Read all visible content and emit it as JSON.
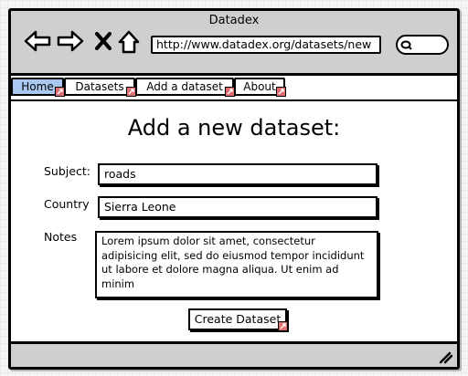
{
  "window": {
    "title": "Datadex"
  },
  "browser": {
    "url": "http://www.datadex.org/datasets/new"
  },
  "tabs": [
    {
      "label": "Home",
      "active": true
    },
    {
      "label": "Datasets",
      "active": false
    },
    {
      "label": "Add a dataset",
      "active": false
    },
    {
      "label": "About",
      "active": false
    }
  ],
  "form": {
    "heading": "Add a new dataset:",
    "subject_label": "Subject:",
    "subject_value": "roads",
    "country_label": "Country",
    "country_value": "Sierra Leone",
    "notes_label": "Notes",
    "notes_value": "Lorem ipsum dolor sit amet, consectetur adipisicing elit, sed do eiusmod tempor incididunt ut labore et dolore magna aliqua. Ut enim ad minim",
    "submit_label": "Create Dataset"
  },
  "colors": {
    "active_tab": "#a8c8f0",
    "chrome": "#cfcfcf",
    "link_marker": "#e07070"
  }
}
